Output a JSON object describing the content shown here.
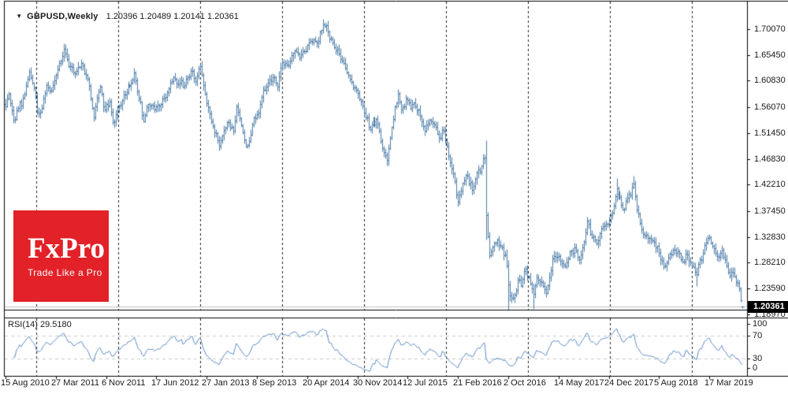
{
  "header": {
    "dropdown_icon": "down-triangle",
    "symbol": "GBPUSD,Weekly",
    "ohlc_text": "1.20396 1.20489 1.20141 1.20361"
  },
  "logo": {
    "title": "FxPro",
    "tagline": "Trade Like a Pro"
  },
  "rsi_panel": {
    "label": "RSI(14)",
    "value": "29.5180"
  },
  "y_axis": {
    "ticks": [
      "1.70070",
      "1.65450",
      "1.60830",
      "1.56070",
      "1.51450",
      "1.46830",
      "1.42210",
      "1.37450",
      "1.32830",
      "1.28210",
      "1.23590",
      "1.18970"
    ],
    "current_price": "1.20361"
  },
  "rsi_axis": {
    "ticks": [
      "100",
      "70",
      "30",
      "0"
    ]
  },
  "x_axis": {
    "dates": [
      "15 Aug 2010",
      "27 Mar 2011",
      "6 Nov 2011",
      "17 Jun 2012",
      "27 Jan 2013",
      "8 Sep 2013",
      "20 Apr 2014",
      "30 Nov 2014",
      "12 Jul 2015",
      "21 Feb 2016",
      "2 Oct 2016",
      "14 May 2017",
      "24 Dec 2017",
      "5 Aug 2018",
      "17 Mar 2019"
    ],
    "weeks_between_labels": 32
  },
  "colors": {
    "bar": "#4a7ba7",
    "rsi_line": "#5b8ac4",
    "grid": "#1f1f1f",
    "rsi_level": "#c9c9c9",
    "price_line": "#c0c0c0",
    "border": "#000000",
    "tag_bg": "#000000",
    "tag_fg": "#ffffff",
    "logo_bg": "#e22128",
    "text": "#1a1a1a"
  },
  "chart_data": {
    "type": "bar",
    "subtype": "ohlc-bars-weekly",
    "symbol": "GBPUSD",
    "timeframe": "Weekly",
    "title": "GBPUSD,Weekly",
    "ylim": [
      1.1897,
      1.7007
    ],
    "weeks_total": 470,
    "current_bar": {
      "open": 1.20396,
      "high": 1.20489,
      "low": 1.20141,
      "close": 1.20361
    },
    "close_anchors": [
      [
        0,
        1.563
      ],
      [
        2,
        1.585
      ],
      [
        5,
        1.538
      ],
      [
        8,
        1.56
      ],
      [
        12,
        1.585
      ],
      [
        15,
        1.625
      ],
      [
        18,
        1.596
      ],
      [
        20,
        1.553
      ],
      [
        23,
        1.56
      ],
      [
        26,
        1.6
      ],
      [
        29,
        1.59
      ],
      [
        33,
        1.628
      ],
      [
        37,
        1.665
      ],
      [
        40,
        1.635
      ],
      [
        44,
        1.622
      ],
      [
        48,
        1.64
      ],
      [
        52,
        1.612
      ],
      [
        56,
        1.543
      ],
      [
        58,
        1.578
      ],
      [
        60,
        1.598
      ],
      [
        63,
        1.556
      ],
      [
        66,
        1.571
      ],
      [
        68,
        1.534
      ],
      [
        71,
        1.555
      ],
      [
        75,
        1.583
      ],
      [
        79,
        1.6
      ],
      [
        82,
        1.623
      ],
      [
        85,
        1.576
      ],
      [
        88,
        1.536
      ],
      [
        91,
        1.566
      ],
      [
        95,
        1.557
      ],
      [
        99,
        1.567
      ],
      [
        103,
        1.588
      ],
      [
        107,
        1.615
      ],
      [
        110,
        1.602
      ],
      [
        114,
        1.601
      ],
      [
        118,
        1.626
      ],
      [
        121,
        1.608
      ],
      [
        124,
        1.635
      ],
      [
        127,
        1.585
      ],
      [
        130,
        1.55
      ],
      [
        133,
        1.516
      ],
      [
        136,
        1.492
      ],
      [
        139,
        1.52
      ],
      [
        142,
        1.534
      ],
      [
        145,
        1.518
      ],
      [
        147,
        1.562
      ],
      [
        150,
        1.528
      ],
      [
        153,
        1.491
      ],
      [
        156,
        1.512
      ],
      [
        158,
        1.542
      ],
      [
        161,
        1.551
      ],
      [
        164,
        1.592
      ],
      [
        167,
        1.604
      ],
      [
        170,
        1.614
      ],
      [
        173,
        1.597
      ],
      [
        176,
        1.642
      ],
      [
        180,
        1.636
      ],
      [
        184,
        1.662
      ],
      [
        187,
        1.65
      ],
      [
        190,
        1.661
      ],
      [
        194,
        1.679
      ],
      [
        198,
        1.676
      ],
      [
        202,
        1.709
      ],
      [
        205,
        1.697
      ],
      [
        208,
        1.676
      ],
      [
        212,
        1.657
      ],
      [
        216,
        1.631
      ],
      [
        220,
        1.606
      ],
      [
        224,
        1.586
      ],
      [
        228,
        1.551
      ],
      [
        232,
        1.521
      ],
      [
        236,
        1.54
      ],
      [
        240,
        1.487
      ],
      [
        243,
        1.466
      ],
      [
        246,
        1.525
      ],
      [
        250,
        1.585
      ],
      [
        252,
        1.556
      ],
      [
        255,
        1.576
      ],
      [
        258,
        1.56
      ],
      [
        261,
        1.563
      ],
      [
        264,
        1.545
      ],
      [
        267,
        1.518
      ],
      [
        270,
        1.539
      ],
      [
        273,
        1.53
      ],
      [
        276,
        1.506
      ],
      [
        279,
        1.518
      ],
      [
        282,
        1.474
      ],
      [
        285,
        1.442
      ],
      [
        288,
        1.392
      ],
      [
        291,
        1.425
      ],
      [
        294,
        1.438
      ],
      [
        297,
        1.413
      ],
      [
        300,
        1.444
      ],
      [
        303,
        1.456
      ],
      [
        305,
        1.47
      ],
      [
        306,
        1.368
      ],
      [
        308,
        1.296
      ],
      [
        310,
        1.311
      ],
      [
        313,
        1.323
      ],
      [
        316,
        1.309
      ],
      [
        318,
        1.297
      ],
      [
        320,
        1.243
      ],
      [
        322,
        1.219
      ],
      [
        324,
        1.225
      ],
      [
        326,
        1.252
      ],
      [
        328,
        1.241
      ],
      [
        331,
        1.272
      ],
      [
        334,
        1.244
      ],
      [
        336,
        1.226
      ],
      [
        338,
        1.256
      ],
      [
        341,
        1.247
      ],
      [
        344,
        1.228
      ],
      [
        346,
        1.256
      ],
      [
        348,
        1.29
      ],
      [
        352,
        1.294
      ],
      [
        354,
        1.281
      ],
      [
        356,
        1.276
      ],
      [
        359,
        1.302
      ],
      [
        362,
        1.309
      ],
      [
        365,
        1.289
      ],
      [
        368,
        1.32
      ],
      [
        370,
        1.358
      ],
      [
        373,
        1.328
      ],
      [
        376,
        1.317
      ],
      [
        379,
        1.344
      ],
      [
        382,
        1.352
      ],
      [
        384,
        1.36
      ],
      [
        386,
        1.372
      ],
      [
        389,
        1.416
      ],
      [
        391,
        1.4
      ],
      [
        393,
        1.378
      ],
      [
        396,
        1.398
      ],
      [
        400,
        1.424
      ],
      [
        402,
        1.378
      ],
      [
        404,
        1.354
      ],
      [
        407,
        1.331
      ],
      [
        410,
        1.327
      ],
      [
        413,
        1.32
      ],
      [
        416,
        1.3
      ],
      [
        419,
        1.276
      ],
      [
        422,
        1.291
      ],
      [
        425,
        1.306
      ],
      [
        428,
        1.302
      ],
      [
        431,
        1.284
      ],
      [
        434,
        1.297
      ],
      [
        437,
        1.277
      ],
      [
        440,
        1.262
      ],
      [
        442,
        1.288
      ],
      [
        444,
        1.3
      ],
      [
        446,
        1.318
      ],
      [
        448,
        1.328
      ],
      [
        450,
        1.312
      ],
      [
        452,
        1.3
      ],
      [
        454,
        1.292
      ],
      [
        456,
        1.306
      ],
      [
        458,
        1.288
      ],
      [
        460,
        1.266
      ],
      [
        462,
        1.266
      ],
      [
        464,
        1.258
      ],
      [
        466,
        1.246
      ],
      [
        467,
        1.236
      ],
      [
        468,
        1.215
      ],
      [
        469,
        1.20361
      ]
    ],
    "range_overrides": [
      [
        37,
        1.6746,
        null
      ],
      [
        202,
        1.719,
        null
      ],
      [
        243,
        null,
        1.4566
      ],
      [
        288,
        null,
        1.3836
      ],
      [
        306,
        1.5018,
        1.323
      ],
      [
        320,
        null,
        1.1946
      ],
      [
        336,
        null,
        1.1988
      ],
      [
        389,
        1.4345,
        null
      ],
      [
        400,
        1.4377,
        null
      ],
      [
        440,
        null,
        1.2409
      ]
    ],
    "rsi": {
      "period": 14,
      "current": 29.518,
      "levels": [
        70,
        30
      ],
      "scale": [
        0,
        100
      ]
    }
  }
}
